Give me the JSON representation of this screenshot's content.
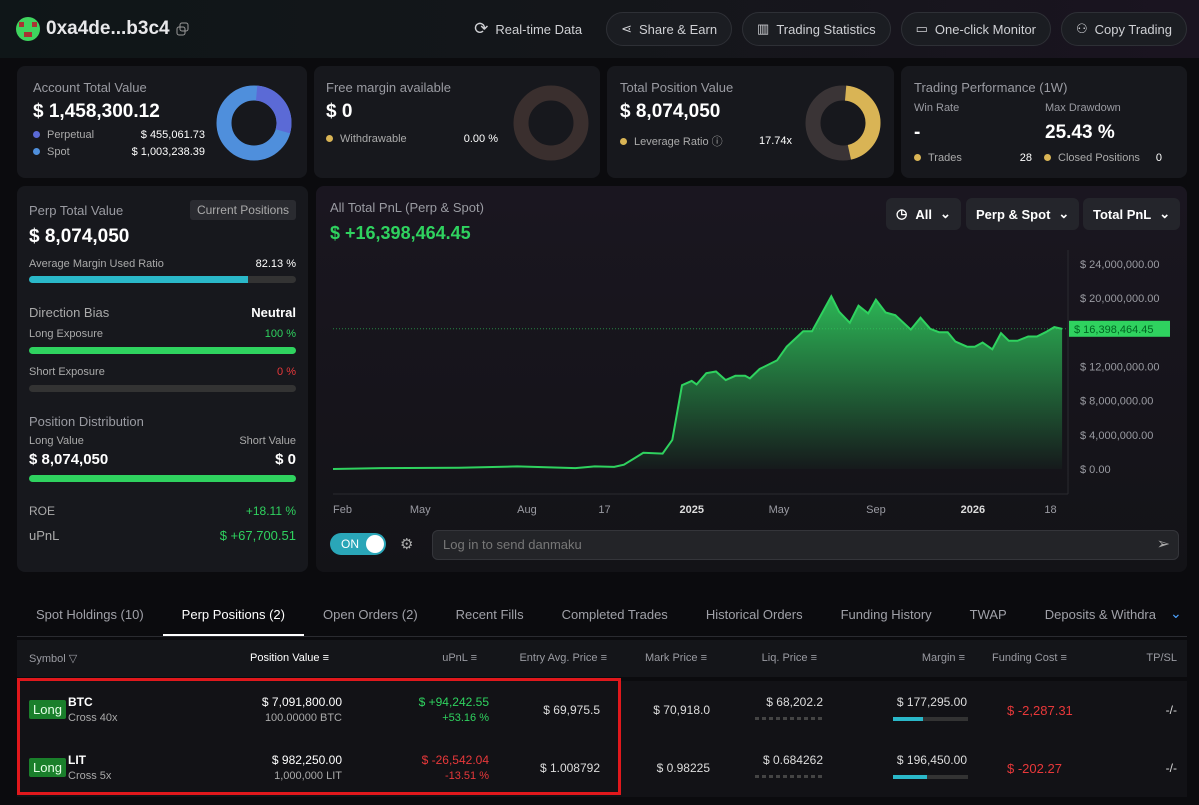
{
  "header": {
    "address": "0xa4de...b3c4",
    "buttons": [
      {
        "label": "Real-time Data",
        "icon": "refresh-icon"
      },
      {
        "label": "Share & Earn",
        "icon": "share-icon"
      },
      {
        "label": "Trading Statistics",
        "icon": "chart-icon"
      },
      {
        "label": "One-click Monitor",
        "icon": "monitor-icon"
      },
      {
        "label": "Copy Trading",
        "icon": "copy-trading-icon"
      }
    ]
  },
  "cards": {
    "account": {
      "title": "Account Total Value",
      "value": "$ 1,458,300.12",
      "items": [
        {
          "label": "Perpetual",
          "value": "$ 455,061.73",
          "color": "#5b6ad6"
        },
        {
          "label": "Spot",
          "value": "$ 1,003,238.39",
          "color": "#4f8fdc"
        }
      ],
      "perp_share": 31.2
    },
    "free": {
      "title": "Free margin available",
      "value": "$ 0",
      "item_label": "Withdrawable",
      "item_value": "0.00 %",
      "color": "#d9b455"
    },
    "position": {
      "title": "Total Position Value",
      "value": "$ 8,074,050",
      "item_label": "Leverage Ratio",
      "item_value": "17.74x",
      "color": "#d9b455"
    },
    "perf": {
      "title": "Trading Performance (1W)",
      "win_rate_label": "Win Rate",
      "win_rate": "-",
      "drawdown_label": "Max Drawdown",
      "drawdown": "25.43 %",
      "trades_label": "Trades",
      "trades": "28",
      "closed_label": "Closed Positions",
      "closed": "0"
    }
  },
  "perp": {
    "title": "Perp Total Value",
    "badge": "Current Positions",
    "value": "$ 8,074,050",
    "margin_label": "Average Margin Used Ratio",
    "margin_value": "82.13 %",
    "margin_pct": 82.13,
    "bias_label": "Direction Bias",
    "bias_value": "Neutral",
    "long_label": "Long Exposure",
    "long_value": "100 %",
    "long_pct": 100,
    "short_label": "Short Exposure",
    "short_value": "0 %",
    "short_pct": 0,
    "dist_label": "Position Distribution",
    "long_val_label": "Long Value",
    "short_val_label": "Short Value",
    "long_val": "$ 8,074,050",
    "short_val": "$ 0",
    "roe_label": "ROE",
    "roe": "+18.11 %",
    "upnl_label": "uPnL",
    "upnl": "$ +67,700.51"
  },
  "chart_panel": {
    "title": "All Total PnL (Perp & Spot)",
    "value": "$ +16,398,464.45",
    "filters": [
      "All",
      "Perp & Spot",
      "Total PnL"
    ],
    "toggle": "ON",
    "danmaku_placeholder": "Log in to send danmaku"
  },
  "chart_data": {
    "type": "area",
    "ylim": [
      0,
      26000000
    ],
    "y_ticks": [
      "$ 24,000,000.00",
      "$ 20,000,000.00",
      "$ 12,000,000.00",
      "$ 8,000,000.00",
      "$ 4,000,000.00",
      "$ 0.00"
    ],
    "y_tick_values": [
      24000000,
      20000000,
      12000000,
      8000000,
      4000000,
      0
    ],
    "x_ticks": [
      {
        "label": "Feb",
        "at": 0
      },
      {
        "label": "May",
        "at": 9
      },
      {
        "label": "Aug",
        "at": 20
      },
      {
        "label": "17",
        "at": 28
      },
      {
        "label": "2025",
        "at": 37
      },
      {
        "label": "May",
        "at": 46
      },
      {
        "label": "Sep",
        "at": 56
      },
      {
        "label": "2026",
        "at": 66
      },
      {
        "label": "18",
        "at": 74
      }
    ],
    "current_label": "$ 16,398,464.45",
    "current_value": 16398464.45,
    "color": "#2fd25f",
    "points": [
      [
        0,
        0
      ],
      [
        5,
        0.1
      ],
      [
        13,
        0.15
      ],
      [
        19,
        0.3
      ],
      [
        25,
        0.1
      ],
      [
        27,
        0.3
      ],
      [
        29,
        0.25
      ],
      [
        30,
        0.5
      ],
      [
        32,
        1.9
      ],
      [
        34,
        1.8
      ],
      [
        35,
        3.4
      ],
      [
        36,
        9.8
      ],
      [
        37,
        10.3
      ],
      [
        37.5,
        9.9
      ],
      [
        38.5,
        11.2
      ],
      [
        39.5,
        11.4
      ],
      [
        40.5,
        10.4
      ],
      [
        41.5,
        10.9
      ],
      [
        42.5,
        10.9
      ],
      [
        43,
        10.6
      ],
      [
        44,
        11.7
      ],
      [
        45.8,
        12.7
      ],
      [
        46.8,
        14.3
      ],
      [
        48.5,
        16.1
      ],
      [
        49.4,
        16.1
      ],
      [
        51.4,
        20.2
      ],
      [
        52.2,
        18.4
      ],
      [
        53.3,
        17.1
      ],
      [
        54.2,
        19.1
      ],
      [
        55.2,
        18.2
      ],
      [
        56,
        19.8
      ],
      [
        57,
        18.3
      ],
      [
        58,
        18.0
      ],
      [
        59.6,
        16.3
      ],
      [
        60.6,
        17.7
      ],
      [
        61.6,
        16.4
      ],
      [
        62.5,
        16.0
      ],
      [
        63.4,
        16.0
      ],
      [
        64.2,
        14.9
      ],
      [
        65.4,
        14.3
      ],
      [
        66.2,
        14.3
      ],
      [
        67,
        14.8
      ],
      [
        68,
        14.0
      ],
      [
        68.9,
        15.9
      ],
      [
        69.7,
        15.0
      ],
      [
        70.6,
        15.0
      ],
      [
        71.7,
        15.5
      ],
      [
        72.6,
        15.5
      ],
      [
        73.5,
        16.0
      ],
      [
        74.4,
        16.6
      ],
      [
        75.2,
        16.4
      ]
    ],
    "points_unit": "millions USD"
  },
  "tabs": [
    "Spot Holdings (10)",
    "Perp Positions (2)",
    "Open Orders (2)",
    "Recent Fills",
    "Completed Trades",
    "Historical Orders",
    "Funding History",
    "TWAP",
    "Deposits & Withdra"
  ],
  "table": {
    "headers": [
      "Symbol",
      "Position Value",
      "uPnL",
      "Entry Avg. Price",
      "Mark Price",
      "Liq. Price",
      "Margin",
      "Funding Cost",
      "TP/SL"
    ],
    "rows": [
      {
        "side": "Long",
        "symbol": "BTC",
        "mode": "Cross 40x",
        "value": "$ 7,091,800.00",
        "size": "100.00000 BTC",
        "upnl": "$ +94,242.55",
        "upnl_pct": "+53.16 %",
        "pos": true,
        "entry": "$ 69,975.5",
        "mark": "$ 70,918.0",
        "liq": "$ 68,202.2",
        "margin": "$ 177,295.00",
        "margin_ratio": 40,
        "funding": "$ -2,287.31",
        "tpsl": "-/-"
      },
      {
        "side": "Long",
        "symbol": "LIT",
        "mode": "Cross 5x",
        "value": "$ 982,250.00",
        "size": "1,000,000 LIT",
        "upnl": "$ -26,542.04",
        "upnl_pct": "-13.51 %",
        "pos": false,
        "entry": "$ 1.008792",
        "mark": "$ 0.98225",
        "liq": "$ 0.684262",
        "margin": "$ 196,450.00",
        "margin_ratio": 45,
        "funding": "$ -202.27",
        "tpsl": "-/-"
      }
    ]
  }
}
